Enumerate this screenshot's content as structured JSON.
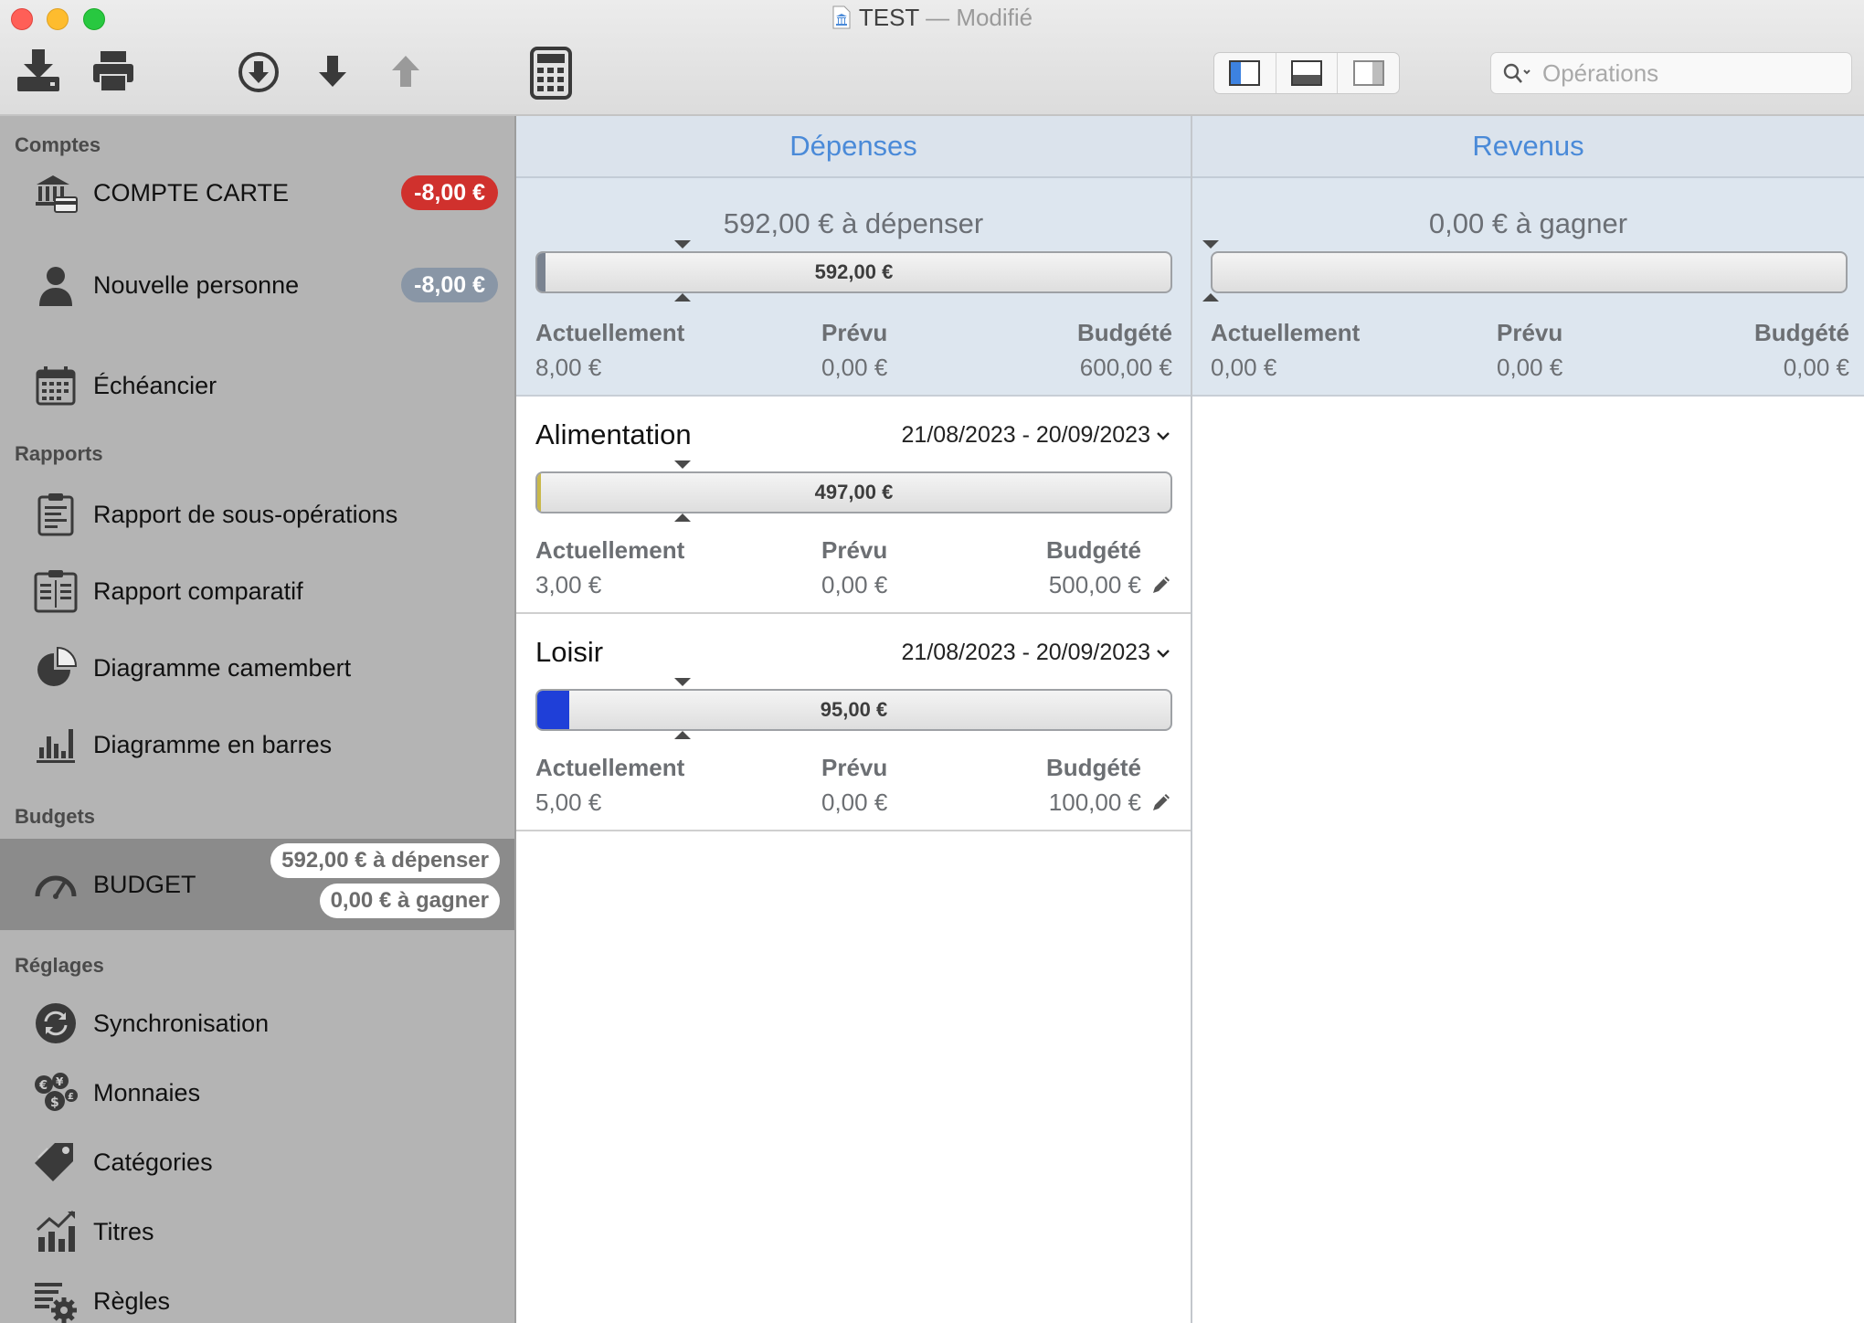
{
  "window": {
    "title": "TEST",
    "title_separator": "—",
    "title_status": "Modifié"
  },
  "toolbar": {
    "search_placeholder": "Opérations",
    "icons": [
      "import-icon",
      "print-icon",
      "download-circle-icon",
      "arrow-down-icon",
      "arrow-up-icon",
      "calculator-icon",
      "layout-left-icon",
      "layout-bottom-icon",
      "layout-right-icon",
      "search-icon"
    ]
  },
  "sidebar": {
    "sections": {
      "accounts": "Comptes",
      "reports": "Rapports",
      "budgets": "Budgets",
      "settings": "Réglages"
    },
    "accounts": [
      {
        "label": "COMPTE CARTE",
        "badge": "-8,00 €",
        "icon": "bank-card-icon"
      },
      {
        "label": "Nouvelle personne",
        "badge": "-8,00 €",
        "icon": "person-icon"
      },
      {
        "label": "Échéancier",
        "icon": "calendar-icon"
      }
    ],
    "reports": [
      {
        "label": "Rapport de sous-opérations",
        "icon": "clipboard-list-icon"
      },
      {
        "label": "Rapport comparatif",
        "icon": "clipboard-compare-icon"
      },
      {
        "label": "Diagramme camembert",
        "icon": "pie-chart-icon"
      },
      {
        "label": "Diagramme en barres",
        "icon": "bar-chart-icon"
      }
    ],
    "budgets": [
      {
        "label": "BUDGET",
        "spend": "592,00 € à dépenser",
        "earn": "0,00 € à gagner",
        "icon": "gauge-icon"
      }
    ],
    "settings": [
      {
        "label": "Synchronisation",
        "icon": "sync-icon"
      },
      {
        "label": "Monnaies",
        "icon": "coins-icon"
      },
      {
        "label": "Catégories",
        "icon": "tags-icon"
      },
      {
        "label": "Titres",
        "icon": "stocks-icon"
      },
      {
        "label": "Règles",
        "icon": "rules-gear-icon"
      }
    ]
  },
  "columns": {
    "expenses": {
      "header": "Dépenses",
      "summary_title": "592,00 € à dépenser",
      "bar_value": "592,00 €",
      "progress": 0.013,
      "labels": {
        "current": "Actuellement",
        "planned": "Prévu",
        "budgeted": "Budgété"
      },
      "current": "8,00 €",
      "planned": "0,00 €",
      "budgeted": "600,00 €"
    },
    "income": {
      "header": "Revenus",
      "summary_title": "0,00 € à gagner",
      "bar_value": "",
      "progress": 0,
      "labels": {
        "current": "Actuellement",
        "planned": "Prévu",
        "budgeted": "Budgété"
      },
      "current": "0,00 €",
      "planned": "0,00 €",
      "budgeted": "0,00 €"
    }
  },
  "categories": [
    {
      "name": "Alimentation",
      "period": "21/08/2023 - 20/09/2023",
      "bar_value": "497,00 €",
      "progress": 0.006,
      "fill_color": "#c9b84a",
      "labels": {
        "current": "Actuellement",
        "planned": "Prévu",
        "budgeted": "Budgété"
      },
      "current": "3,00 €",
      "planned": "0,00 €",
      "budgeted": "500,00 €"
    },
    {
      "name": "Loisir",
      "period": "21/08/2023 - 20/09/2023",
      "bar_value": "95,00 €",
      "progress": 0.05,
      "fill_color": "#1f3fd8",
      "labels": {
        "current": "Actuellement",
        "planned": "Prévu",
        "budgeted": "Budgété"
      },
      "current": "5,00 €",
      "planned": "0,00 €",
      "budgeted": "100,00 €"
    }
  ],
  "colors": {
    "sidebar_bg": "#b4b4b4",
    "selected_bg": "#8b8b8b",
    "badge_red": "#d0312d",
    "badge_grey": "#8996a6",
    "header_blue": "#4a8ad8",
    "summary_bg": "#dde6ef"
  }
}
